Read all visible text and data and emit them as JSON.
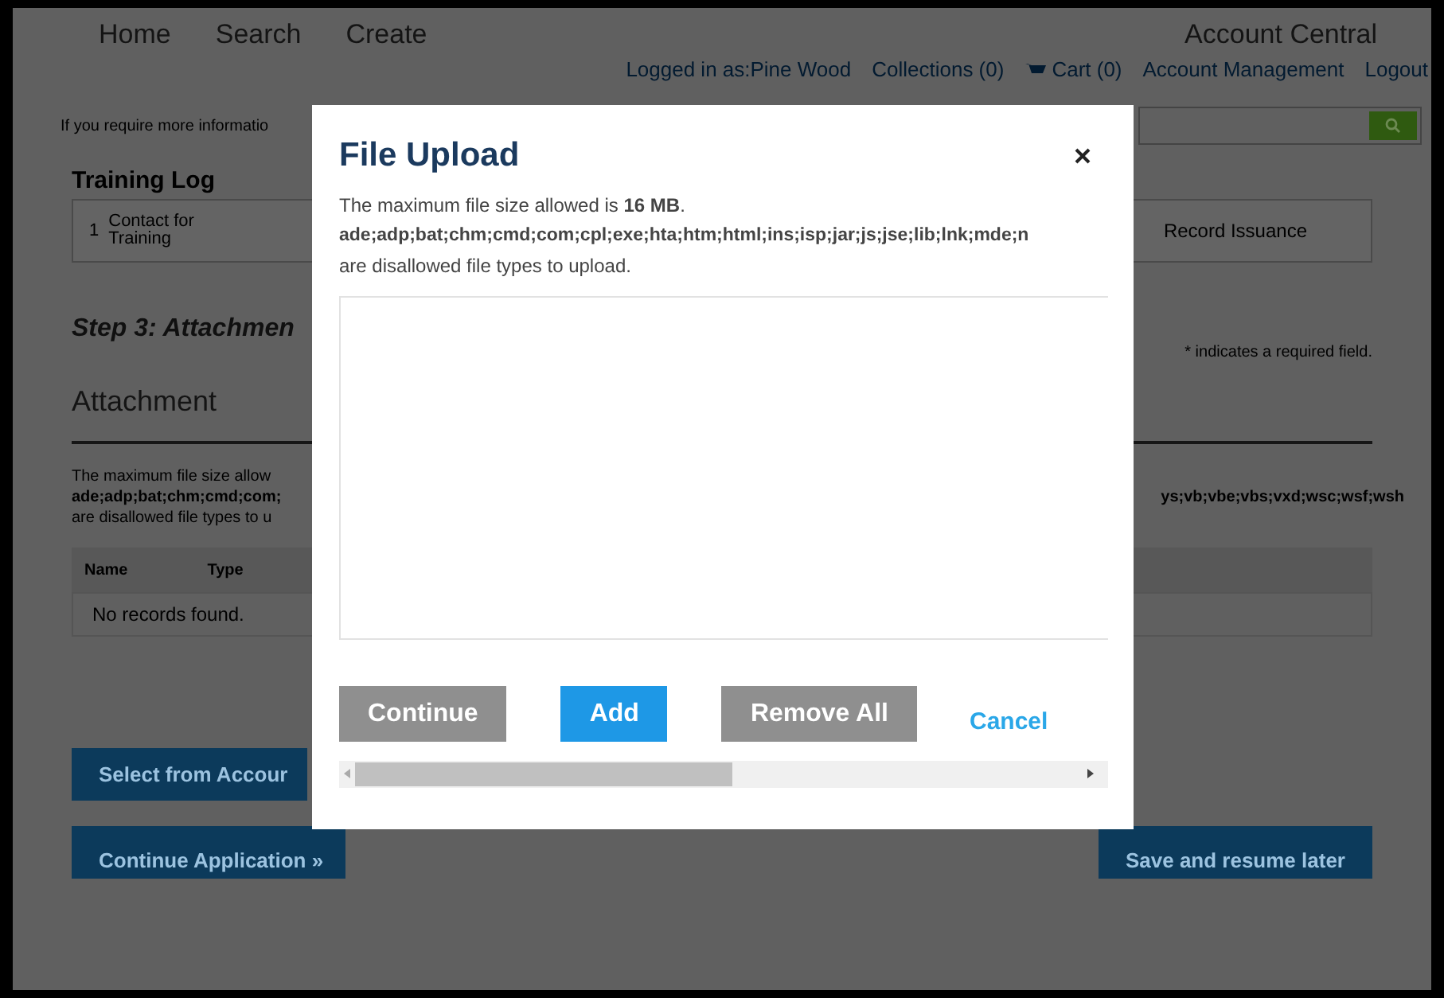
{
  "nav": {
    "items": [
      "Home",
      "Search",
      "Create"
    ],
    "account": "Account Central"
  },
  "user_links": [
    "Logged in as:Pine Wood",
    "Collections (0)",
    "Cart (0)",
    "Account Management",
    "Logout"
  ],
  "info_text": "If you require more informatio",
  "training_log": {
    "title": "Training Log",
    "steps": [
      {
        "number": "1",
        "label": "Contact for Training"
      },
      {
        "label": "Record Issuance"
      }
    ]
  },
  "step_title": "Step 3: Attachmen",
  "required_note": "* indicates a required field.",
  "attachment": {
    "title": "Attachment",
    "notes": [
      "The maximum file size allow",
      "ade;adp;bat;chm;cmd;com;",
      "are disallowed file types to u"
    ],
    "notes_right": "ys;vb;vbe;vbs;vxd;wsc;wsf;wsh",
    "table": {
      "columns": [
        "Name",
        "Type"
      ],
      "empty": "No records found."
    }
  },
  "page_buttons": [
    "Select from Accour",
    "Continue Application »",
    "Save and resume later"
  ],
  "dialog": {
    "title": "File Upload",
    "size_text": "The maximum file size allowed is **16 MB**.",
    "types": "ade;adp;bat;chm;cmd;com;cpl;exe;hta;htm;html;ins;isp;jar;js;jse;lib;lnk;mde;n",
    "types_note": "are disallowed file types to upload.",
    "buttons": [
      {
        "kind": "button",
        "label": "Continue",
        "disabled": true
      },
      {
        "kind": "button",
        "label": "Add",
        "disabled": false
      },
      {
        "kind": "button",
        "label": "Remove All",
        "disabled": true
      },
      {
        "kind": "link",
        "label": "Cancel",
        "disabled": false
      }
    ]
  }
}
